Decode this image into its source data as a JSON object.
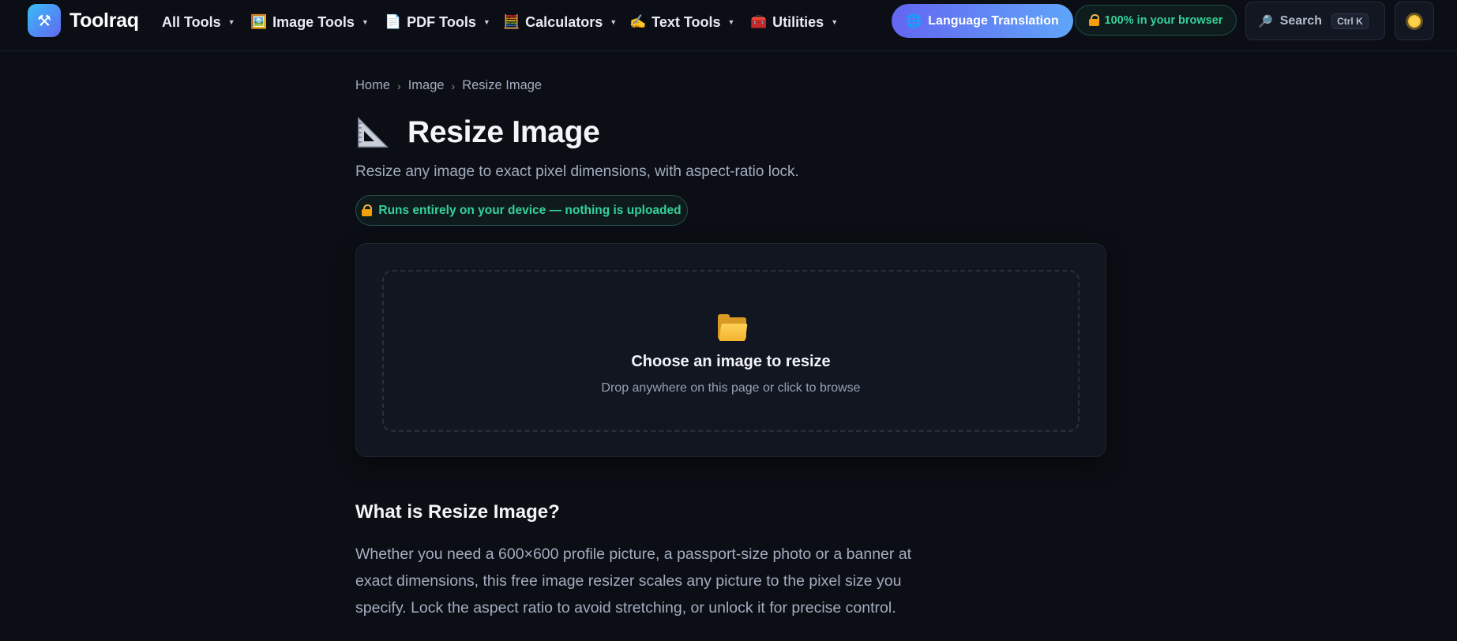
{
  "header": {
    "brand": {
      "name": "Toolraq",
      "logo_icon": "tools-icon"
    },
    "nav": [
      {
        "label": "All Tools",
        "icon": ""
      },
      {
        "label": "Image Tools",
        "icon": "🖼️"
      },
      {
        "label": "PDF Tools",
        "icon": "📄"
      },
      {
        "label": "Calculators",
        "icon": "🧮"
      },
      {
        "label": "Text Tools",
        "icon": "✍️"
      },
      {
        "label": "Utilities",
        "icon": "🧰"
      }
    ],
    "language_button": {
      "label": "Language Translation",
      "icon": "🌐"
    },
    "browser_badge": {
      "label": "100% in your browser"
    },
    "search": {
      "label": "Search",
      "shortcut": "Ctrl K",
      "icon": "🔎"
    },
    "theme_toggle": {
      "icon": "sun-icon"
    }
  },
  "breadcrumb": {
    "items": [
      "Home",
      "Image",
      "Resize Image"
    ],
    "separator": "›"
  },
  "page": {
    "title": "Resize Image",
    "title_icon": "triangular-ruler-icon",
    "subtitle": "Resize any image to exact pixel dimensions, with aspect-ratio lock.",
    "privacy_pill": "Runs entirely on your device — nothing is uploaded"
  },
  "dropzone": {
    "icon": "folder-icon",
    "title": "Choose an image to resize",
    "hint": "Drop anywhere on this page or click to browse"
  },
  "about": {
    "heading": "What is Resize Image?",
    "paragraph": "Whether you need a 600×600 profile picture, a passport-size photo or a banner at exact dimensions, this free image resizer scales any picture to the pixel size you specify. Lock the aspect ratio to avoid stretching, or unlock it for precise control."
  },
  "colors": {
    "background": "#0b0e14",
    "accent_gradient_start": "#6366f1",
    "accent_gradient_end": "#60a5fa",
    "success_text": "#34d399"
  }
}
